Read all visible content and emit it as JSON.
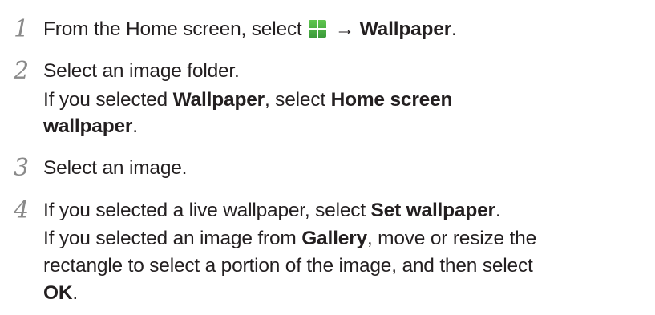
{
  "steps": [
    {
      "number": "1",
      "lines": [
        [
          {
            "t": "From the Home screen, select "
          },
          {
            "icon": "plus-grid-icon"
          },
          {
            "t": " → "
          },
          {
            "t": "Wallpaper",
            "b": true
          },
          {
            "t": "."
          }
        ]
      ]
    },
    {
      "number": "2",
      "lines": [
        [
          {
            "t": "Select an image folder."
          }
        ],
        [
          {
            "t": "If you selected "
          },
          {
            "t": "Wallpaper",
            "b": true
          },
          {
            "t": ", select "
          },
          {
            "t": "Home screen",
            "b": true
          }
        ],
        [
          {
            "t": "wallpaper",
            "b": true
          },
          {
            "t": "."
          }
        ]
      ]
    },
    {
      "number": "3",
      "lines": [
        [
          {
            "t": "Select an image."
          }
        ]
      ]
    },
    {
      "number": "4",
      "lines": [
        [
          {
            "t": "If you selected a live wallpaper, select "
          },
          {
            "t": "Set wallpaper",
            "b": true
          },
          {
            "t": "."
          }
        ],
        [
          {
            "t": "If you selected an image from "
          },
          {
            "t": "Gallery",
            "b": true
          },
          {
            "t": ", move or resize the"
          }
        ],
        [
          {
            "t": "rectangle to select a portion of the image, and then select"
          }
        ],
        [
          {
            "t": "OK",
            "b": true
          },
          {
            "t": "."
          }
        ]
      ]
    }
  ]
}
